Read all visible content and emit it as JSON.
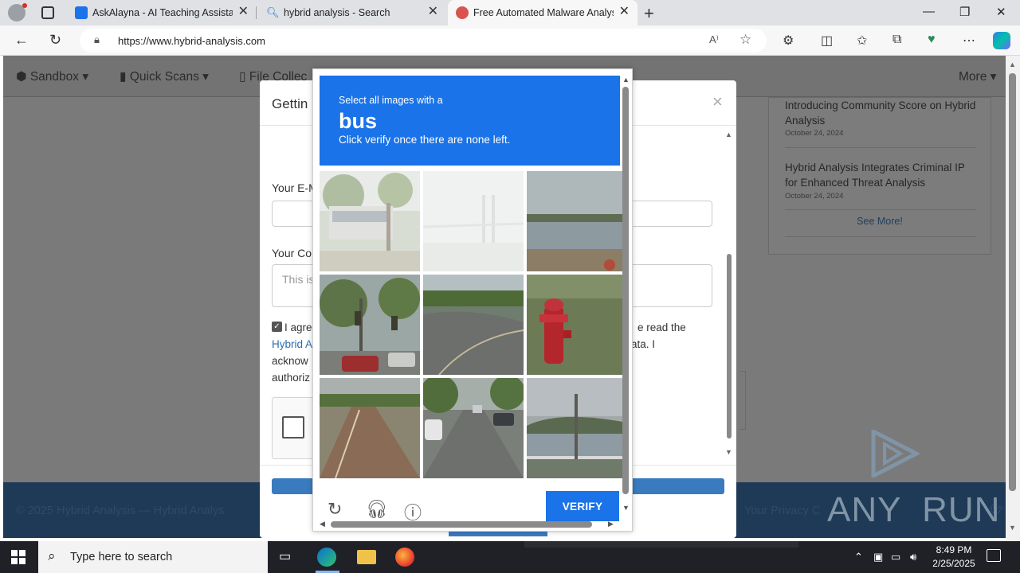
{
  "browser": {
    "tabs": [
      {
        "title": "AskAlayna - AI Teaching Assistant"
      },
      {
        "title": "hybrid analysis - Search"
      },
      {
        "title": "Free Automated Malware Analysis"
      }
    ],
    "url": "https://www.hybrid-analysis.com",
    "read_aloud": "A⁾"
  },
  "site": {
    "nav": [
      {
        "label": "Sandbox ▾"
      },
      {
        "label": "Quick Scans ▾"
      },
      {
        "label": "File Collec"
      },
      {
        "label": "More ▾"
      }
    ],
    "news": [
      {
        "title": "Introducing Community Score on Hybrid Analysis",
        "date": "October 24, 2024"
      },
      {
        "title": "Hybrid Analysis Integrates Criminal IP for Enhanced Threat Analysis",
        "date": "October 24, 2024"
      }
    ],
    "see_more": "See More!",
    "footer_copy": "© 2025 Hybrid Analysis — Hybrid Analys",
    "footer_privacy": "Your Privacy C",
    "watermark": "ANY  RUN"
  },
  "modal": {
    "title": "Gettin",
    "close": "×",
    "email_label": "Your E-M",
    "comment_label": "Your Co",
    "comment_placeholder": "This is",
    "agree_line1": "I agre",
    "agree_line1_tail": "e read the",
    "agree_link": "Hybrid A",
    "agree_line2_tail": "ata. I",
    "agree_line3": "acknow",
    "agree_line4": "authoriz"
  },
  "captcha": {
    "line1": "Select all images with a",
    "keyword": "bus",
    "line3": "Click verify once there are none left.",
    "verify_label": "VERIFY",
    "tiles": [
      "bus-in-trees",
      "foggy-bridge",
      "riverbank",
      "traffic-lights",
      "road-curve",
      "fire-hydrant",
      "road-edge",
      "street-parked-cars",
      "river-fence"
    ]
  },
  "taskbar": {
    "search_placeholder": "Type here to search",
    "time": "8:49 PM",
    "date": "2/25/2025"
  }
}
